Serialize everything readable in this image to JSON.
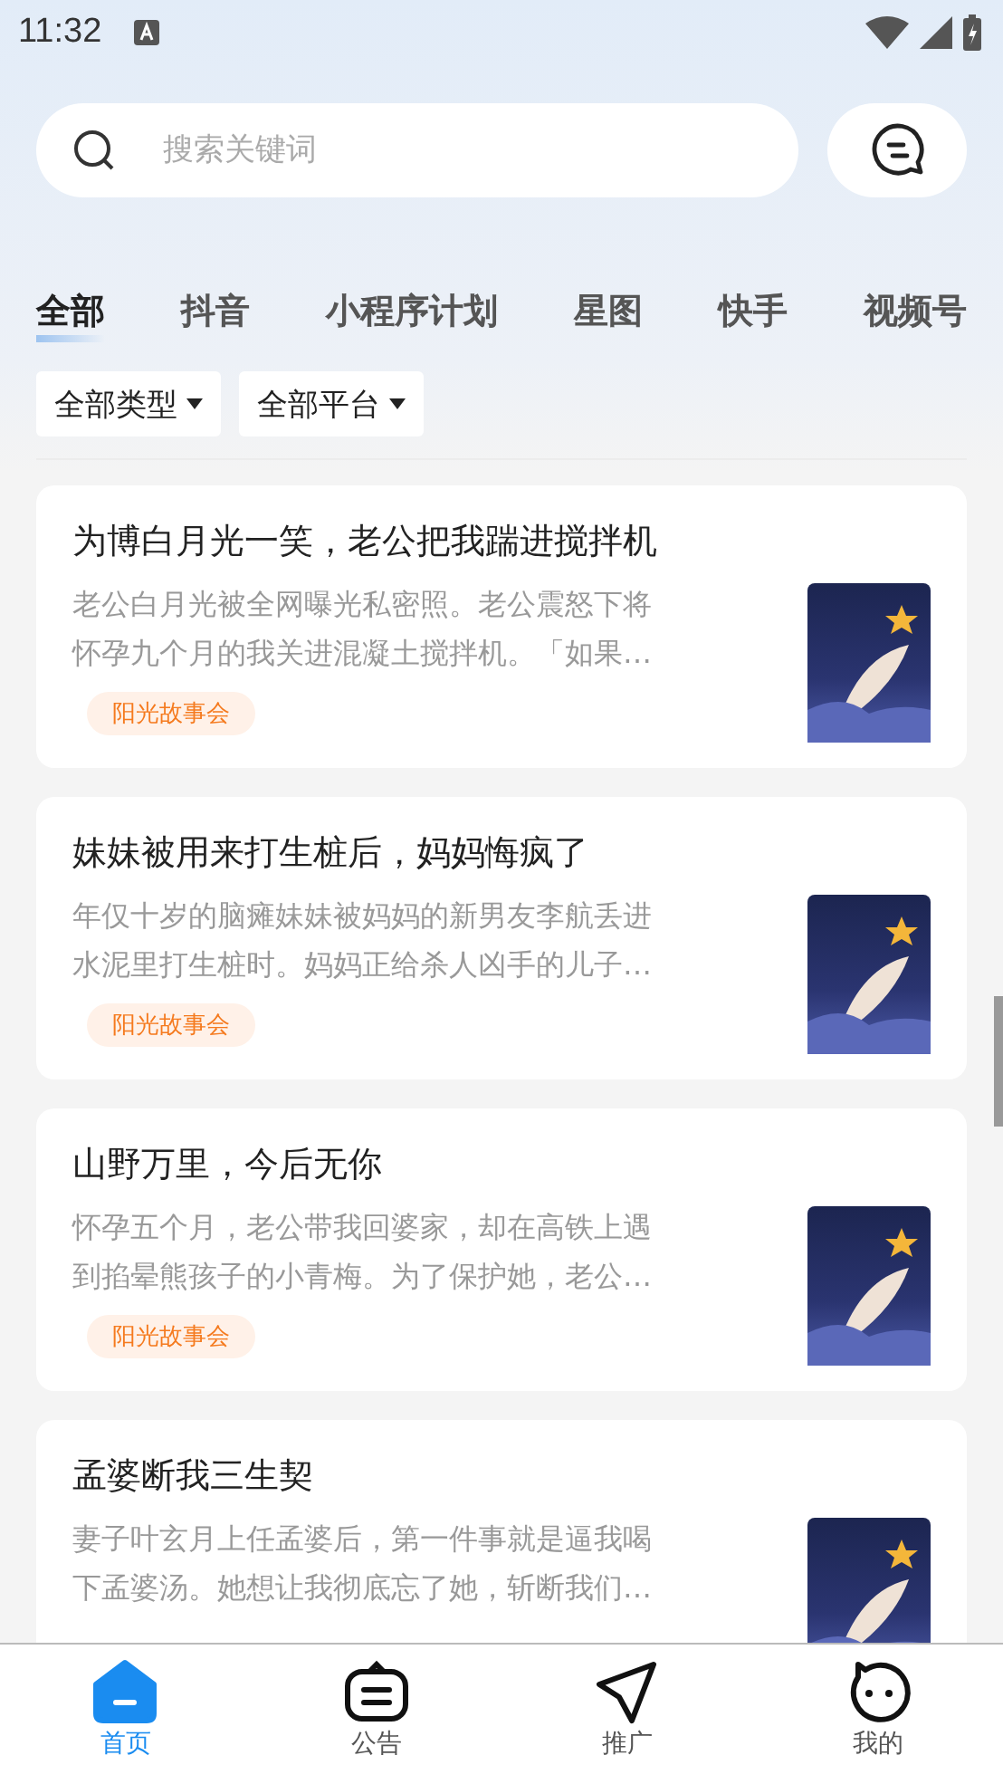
{
  "status_bar": {
    "time": "11:32"
  },
  "search": {
    "placeholder": "搜索关键词"
  },
  "tabs": [
    {
      "label": "全部",
      "selected": true
    },
    {
      "label": "抖音",
      "selected": false
    },
    {
      "label": "小程序计划",
      "selected": false
    },
    {
      "label": "星图",
      "selected": false
    },
    {
      "label": "快手",
      "selected": false
    },
    {
      "label": "视频号",
      "selected": false
    }
  ],
  "filters": [
    {
      "label": "全部类型"
    },
    {
      "label": "全部平台"
    }
  ],
  "stories": [
    {
      "title": "为博白月光一笑，老公把我踹进搅拌机",
      "summary_lines": [
        "老公白月光被全网曝光私密照。老公震怒下将",
        "怀孕九个月的我关进混凝土搅拌机。「如果…"
      ],
      "tag": "阳光故事会"
    },
    {
      "title": "妹妹被用来打生桩后，妈妈悔疯了",
      "summary_lines": [
        "年仅十岁的脑瘫妹妹被妈妈的新男友李航丢进",
        "水泥里打生桩时。妈妈正给杀人凶手的儿子…"
      ],
      "tag": "阳光故事会"
    },
    {
      "title": "山野万里，今后无你",
      "summary_lines": [
        "怀孕五个月，老公带我回婆家，却在高铁上遇",
        "到掐晕熊孩子的小青梅。为了保护她，老公…"
      ],
      "tag": "阳光故事会"
    },
    {
      "title": "孟婆断我三生契",
      "summary_lines": [
        "妻子叶玄月上任孟婆后，第一件事就是逼我喝",
        "下孟婆汤。她想让我彻底忘了她，斩断我们…"
      ]
    }
  ],
  "bottom_nav": [
    {
      "label": "首页",
      "kind": "home",
      "selected": true
    },
    {
      "label": "公告",
      "kind": "notice",
      "selected": false
    },
    {
      "label": "推广",
      "kind": "send",
      "selected": false
    },
    {
      "label": "我的",
      "kind": "face",
      "selected": false
    }
  ]
}
